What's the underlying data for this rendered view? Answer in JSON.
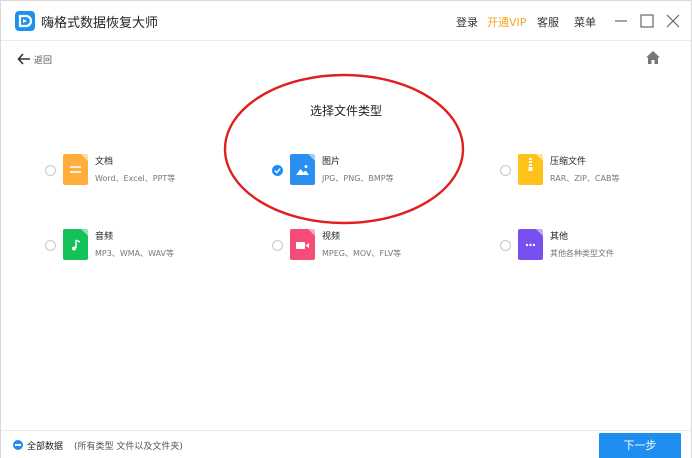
{
  "app": {
    "title": "嗨格式数据恢复大师"
  },
  "header": {
    "menu": [
      "登录",
      "开通VIP",
      "客服",
      "菜单"
    ],
    "vip_color": "#f5a623"
  },
  "nav": {
    "back_label": "返回",
    "back_icon": "arrow-left-icon",
    "home_icon": "home-icon"
  },
  "main": {
    "title": "选择文件类型"
  },
  "file_types": [
    {
      "name": "文档",
      "desc": "Word、Excel、PPT等",
      "color": "#ffae3c",
      "icon": "document-icon",
      "checked": false
    },
    {
      "name": "图片",
      "desc": "JPG、PNG、BMP等",
      "color": "#2b8ff2",
      "icon": "image-icon",
      "checked": true
    },
    {
      "name": "压缩文件",
      "desc": "RAR、ZIP、CAB等",
      "color": "#ffc21a",
      "icon": "zip-icon",
      "checked": false
    },
    {
      "name": "音频",
      "desc": "MP3、WMA、WAV等",
      "color": "#14c25a",
      "icon": "music-icon",
      "checked": false
    },
    {
      "name": "视频",
      "desc": "MPEG、MOV、FLV等",
      "color": "#f54d78",
      "icon": "video-icon",
      "checked": false
    },
    {
      "name": "其他",
      "desc": "其他各种类型文件",
      "color": "#7a4ff0",
      "icon": "more-icon",
      "checked": false
    }
  ],
  "footer": {
    "all_label": "全部数据",
    "all_desc": "(所有类型 文件以及文件夹)",
    "next_label": "下一步"
  },
  "colors": {
    "accent": "#1e8ff0",
    "annotation": "#e0201f"
  }
}
